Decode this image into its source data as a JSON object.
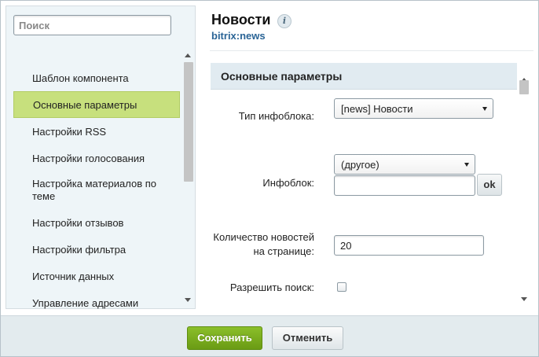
{
  "sidebar": {
    "search": {
      "placeholder": "Поиск",
      "value": ""
    },
    "items": [
      {
        "label": "Шаблон компонента",
        "active": false
      },
      {
        "label": "Основные параметры",
        "active": true
      },
      {
        "label": "Настройки RSS",
        "active": false
      },
      {
        "label": "Настройки голосования",
        "active": false
      },
      {
        "label": "Настройка материалов по теме",
        "active": false
      },
      {
        "label": "Настройки отзывов",
        "active": false
      },
      {
        "label": "Настройки фильтра",
        "active": false
      },
      {
        "label": "Источник данных",
        "active": false
      },
      {
        "label": "Управление адресами",
        "active": false
      }
    ]
  },
  "header": {
    "title": "Новости",
    "subtitle": "bitrix:news",
    "info_icon": "i"
  },
  "main": {
    "section_title": "Основные параметры",
    "fields": {
      "iblock_type": {
        "label": "Тип инфоблока:",
        "value": "[news] Новости"
      },
      "iblock": {
        "label": "Инфоблок:",
        "select_value": "(другое)",
        "input_value": "",
        "ok_label": "ok"
      },
      "news_count": {
        "label_line1": "Количество новостей",
        "label_line2": "на странице:",
        "value": "20"
      },
      "allow_search": {
        "label": "Разрешить поиск:",
        "checked": false
      }
    }
  },
  "footer": {
    "save_label": "Сохранить",
    "cancel_label": "Отменить"
  },
  "colors": {
    "accent_green": "#7aae1f",
    "active_item": "#c7e07d",
    "section_bg": "#e1ebf1",
    "link_blue": "#2a6496"
  }
}
